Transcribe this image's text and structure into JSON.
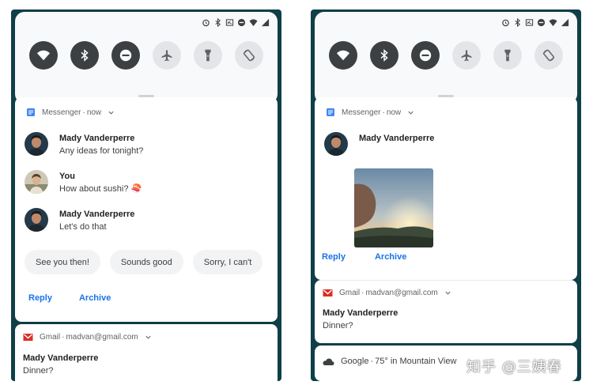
{
  "left": {
    "notification": {
      "app_name": "Messenger",
      "time": "now",
      "messages": [
        {
          "sender": "Mady Vanderperre",
          "text": "Any ideas for tonight?"
        },
        {
          "sender": "You",
          "text": "How about sushi? 🍣"
        },
        {
          "sender": "Mady Vanderperre",
          "text": "Let's do that"
        }
      ],
      "smart_replies": [
        "See you then!",
        "Sounds good",
        "Sorry, I can't"
      ],
      "actions": [
        "Reply",
        "Archive"
      ]
    },
    "gmail": {
      "app_name": "Gmail",
      "account": "madvan@gmail.com",
      "sender": "Mady Vanderperre",
      "body": "Dinner?"
    }
  },
  "right": {
    "notification": {
      "app_name": "Messenger",
      "time": "now",
      "sender": "Mady Vanderperre",
      "actions": [
        "Reply",
        "Archive"
      ]
    },
    "gmail": {
      "app_name": "Gmail",
      "account": "madvan@gmail.com",
      "sender": "Mady Vanderperre",
      "body": "Dinner?"
    },
    "google": {
      "app_name": "Google",
      "text": "75° in Mountain View"
    }
  },
  "watermark": "知乎 @三姨春",
  "colors": {
    "accent": "#1a73e8",
    "tile_on": "#3c4043",
    "tile_off": "#e3e5e8",
    "gmail_red": "#d93025",
    "messenger_blue": "#4285f4"
  }
}
